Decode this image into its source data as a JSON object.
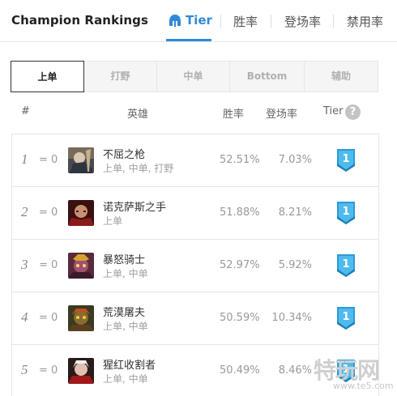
{
  "header": {
    "title": "Champion Rankings",
    "tabs": [
      "Tier",
      "胜率",
      "登场率",
      "禁用率"
    ],
    "active_tab": "Tier",
    "accent_color": "#2f8ad8"
  },
  "positions": {
    "items": [
      "上单",
      "打野",
      "中单",
      "Bottom",
      "辅助"
    ],
    "active": "上单"
  },
  "columns": {
    "rank": "#",
    "hero": "英雄",
    "winrate": "胜率",
    "pickrate": "登场率",
    "tier": "Tier",
    "help": "?"
  },
  "rows": [
    {
      "rank": "1",
      "delta": "= 0",
      "name": "不屈之枪",
      "positions": "上单, 中单, 打野",
      "winrate": "52.51%",
      "pickrate": "7.03%",
      "tier": "1",
      "icon": "champion-portrait"
    },
    {
      "rank": "2",
      "delta": "= 0",
      "name": "诺克萨斯之手",
      "positions": "上单",
      "winrate": "51.88%",
      "pickrate": "8.21%",
      "tier": "1",
      "icon": "champion-portrait"
    },
    {
      "rank": "3",
      "delta": "= 0",
      "name": "暴怒骑士",
      "positions": "上单, 中单",
      "winrate": "52.97%",
      "pickrate": "5.92%",
      "tier": "1",
      "icon": "champion-portrait"
    },
    {
      "rank": "4",
      "delta": "= 0",
      "name": "荒漠屠夫",
      "positions": "上单, 中单",
      "winrate": "50.59%",
      "pickrate": "10.34%",
      "tier": "1",
      "icon": "champion-portrait"
    },
    {
      "rank": "5",
      "delta": "= 0",
      "name": "猩红收割者",
      "positions": "上单, 中单",
      "winrate": "50.49%",
      "pickrate": "8.46%",
      "tier": "1",
      "icon": "champion-portrait"
    }
  ],
  "watermark": {
    "text": "特玩网",
    "site": "www.te5.com"
  },
  "tier_badge_color": "#39a8e0"
}
